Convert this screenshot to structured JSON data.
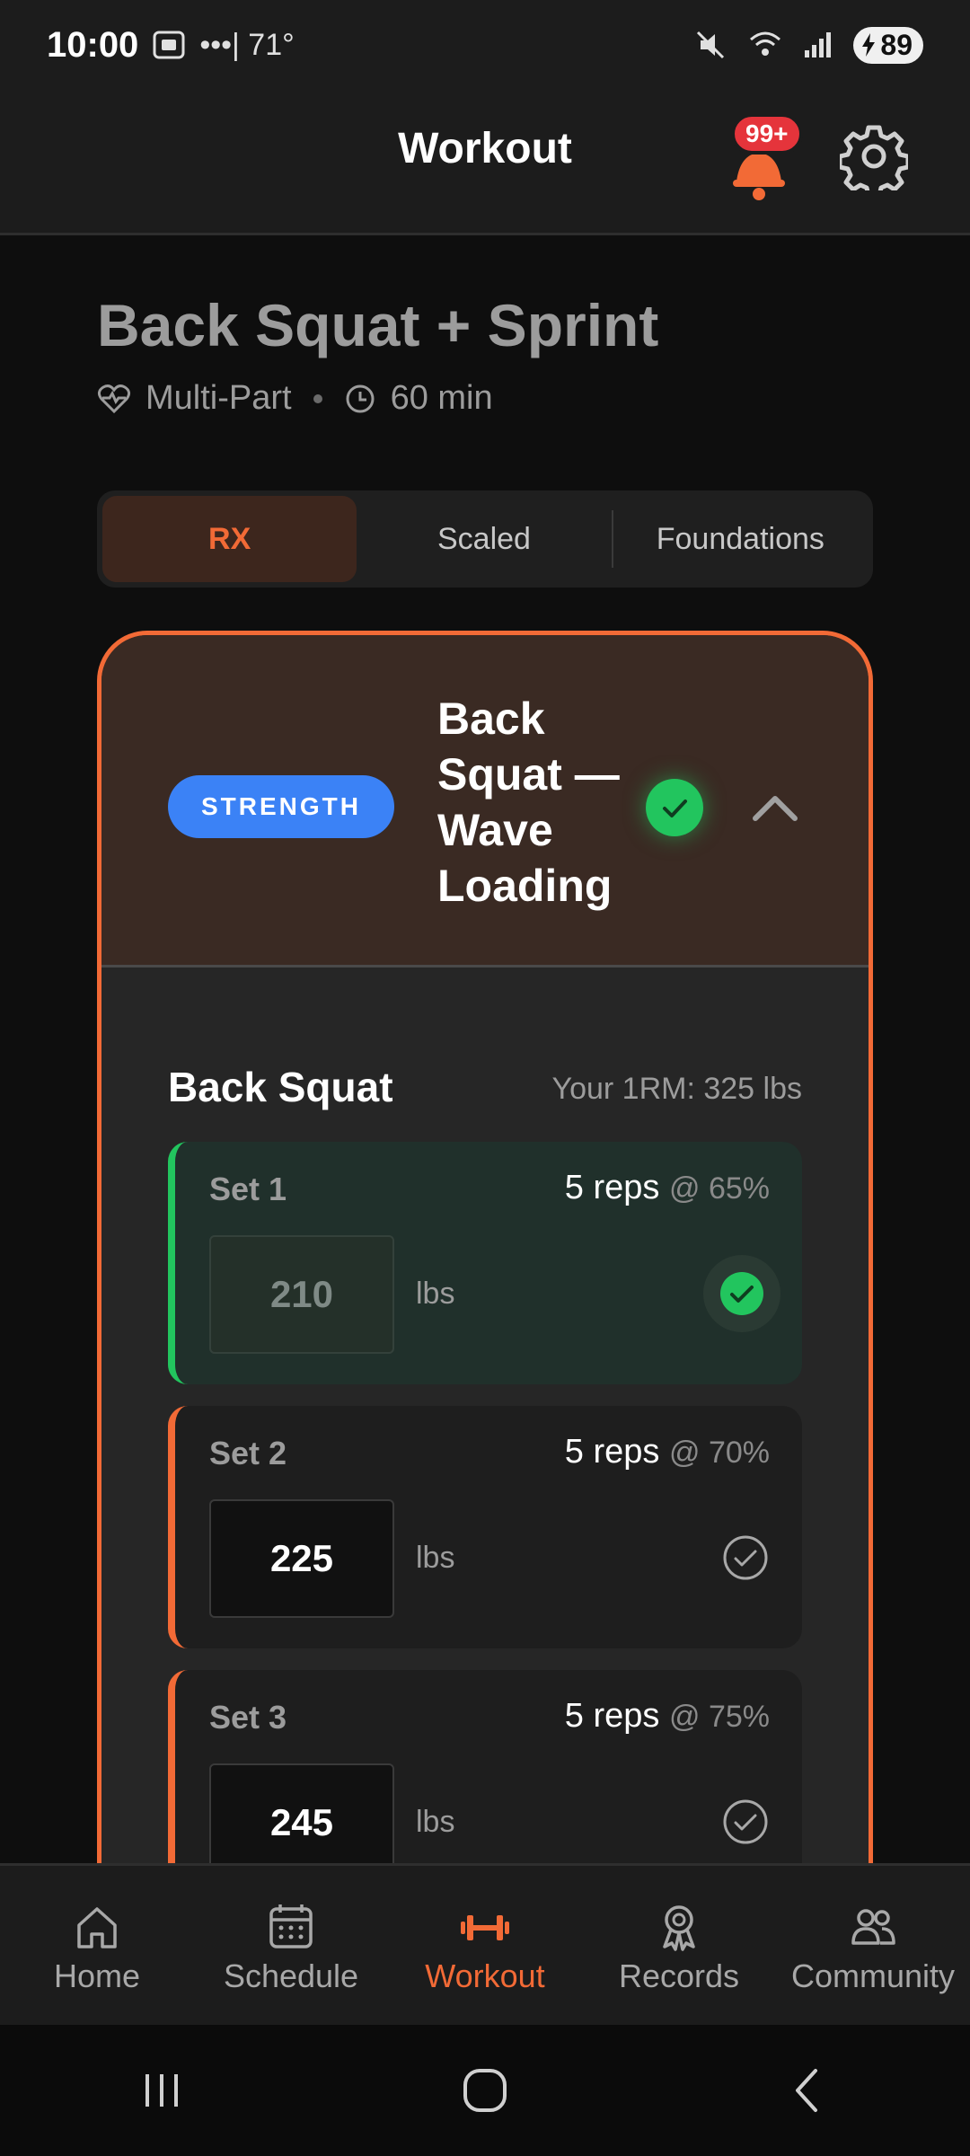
{
  "status_bar": {
    "time": "10:00",
    "extra": "•••| 71°",
    "battery": "89"
  },
  "header": {
    "title": "Workout",
    "notification_count": "99+"
  },
  "workout": {
    "title": "Back Squat + Sprint",
    "type": "Multi-Part",
    "duration": "60 min"
  },
  "tabs": [
    {
      "label": "RX",
      "active": true
    },
    {
      "label": "Scaled",
      "active": false
    },
    {
      "label": "Foundations",
      "active": false
    }
  ],
  "block": {
    "tag": "STRENGTH",
    "title": "Back Squat — Wave Loading",
    "exercise": "Back Squat",
    "one_rm": "Your 1RM: 325 lbs",
    "sets": [
      {
        "label": "Set 1",
        "reps": "5 reps",
        "pct": "@ 65%",
        "weight": "210",
        "unit": "lbs",
        "done": true
      },
      {
        "label": "Set 2",
        "reps": "5 reps",
        "pct": "@ 70%",
        "weight": "225",
        "unit": "lbs",
        "done": false
      },
      {
        "label": "Set 3",
        "reps": "5 reps",
        "pct": "@ 75%",
        "weight": "245",
        "unit": "lbs",
        "done": false
      }
    ]
  },
  "bottom_nav": [
    {
      "label": "Home",
      "icon": "home-icon",
      "active": false
    },
    {
      "label": "Schedule",
      "icon": "calendar-icon",
      "active": false
    },
    {
      "label": "Workout",
      "icon": "dumbbell-icon",
      "active": true
    },
    {
      "label": "Records",
      "icon": "medal-icon",
      "active": false
    },
    {
      "label": "Community",
      "icon": "people-icon",
      "active": false
    }
  ],
  "colors": {
    "accent": "#f26a36",
    "success": "#22c55e",
    "tag_blue": "#3b82f6",
    "badge_red": "#e5343b"
  }
}
